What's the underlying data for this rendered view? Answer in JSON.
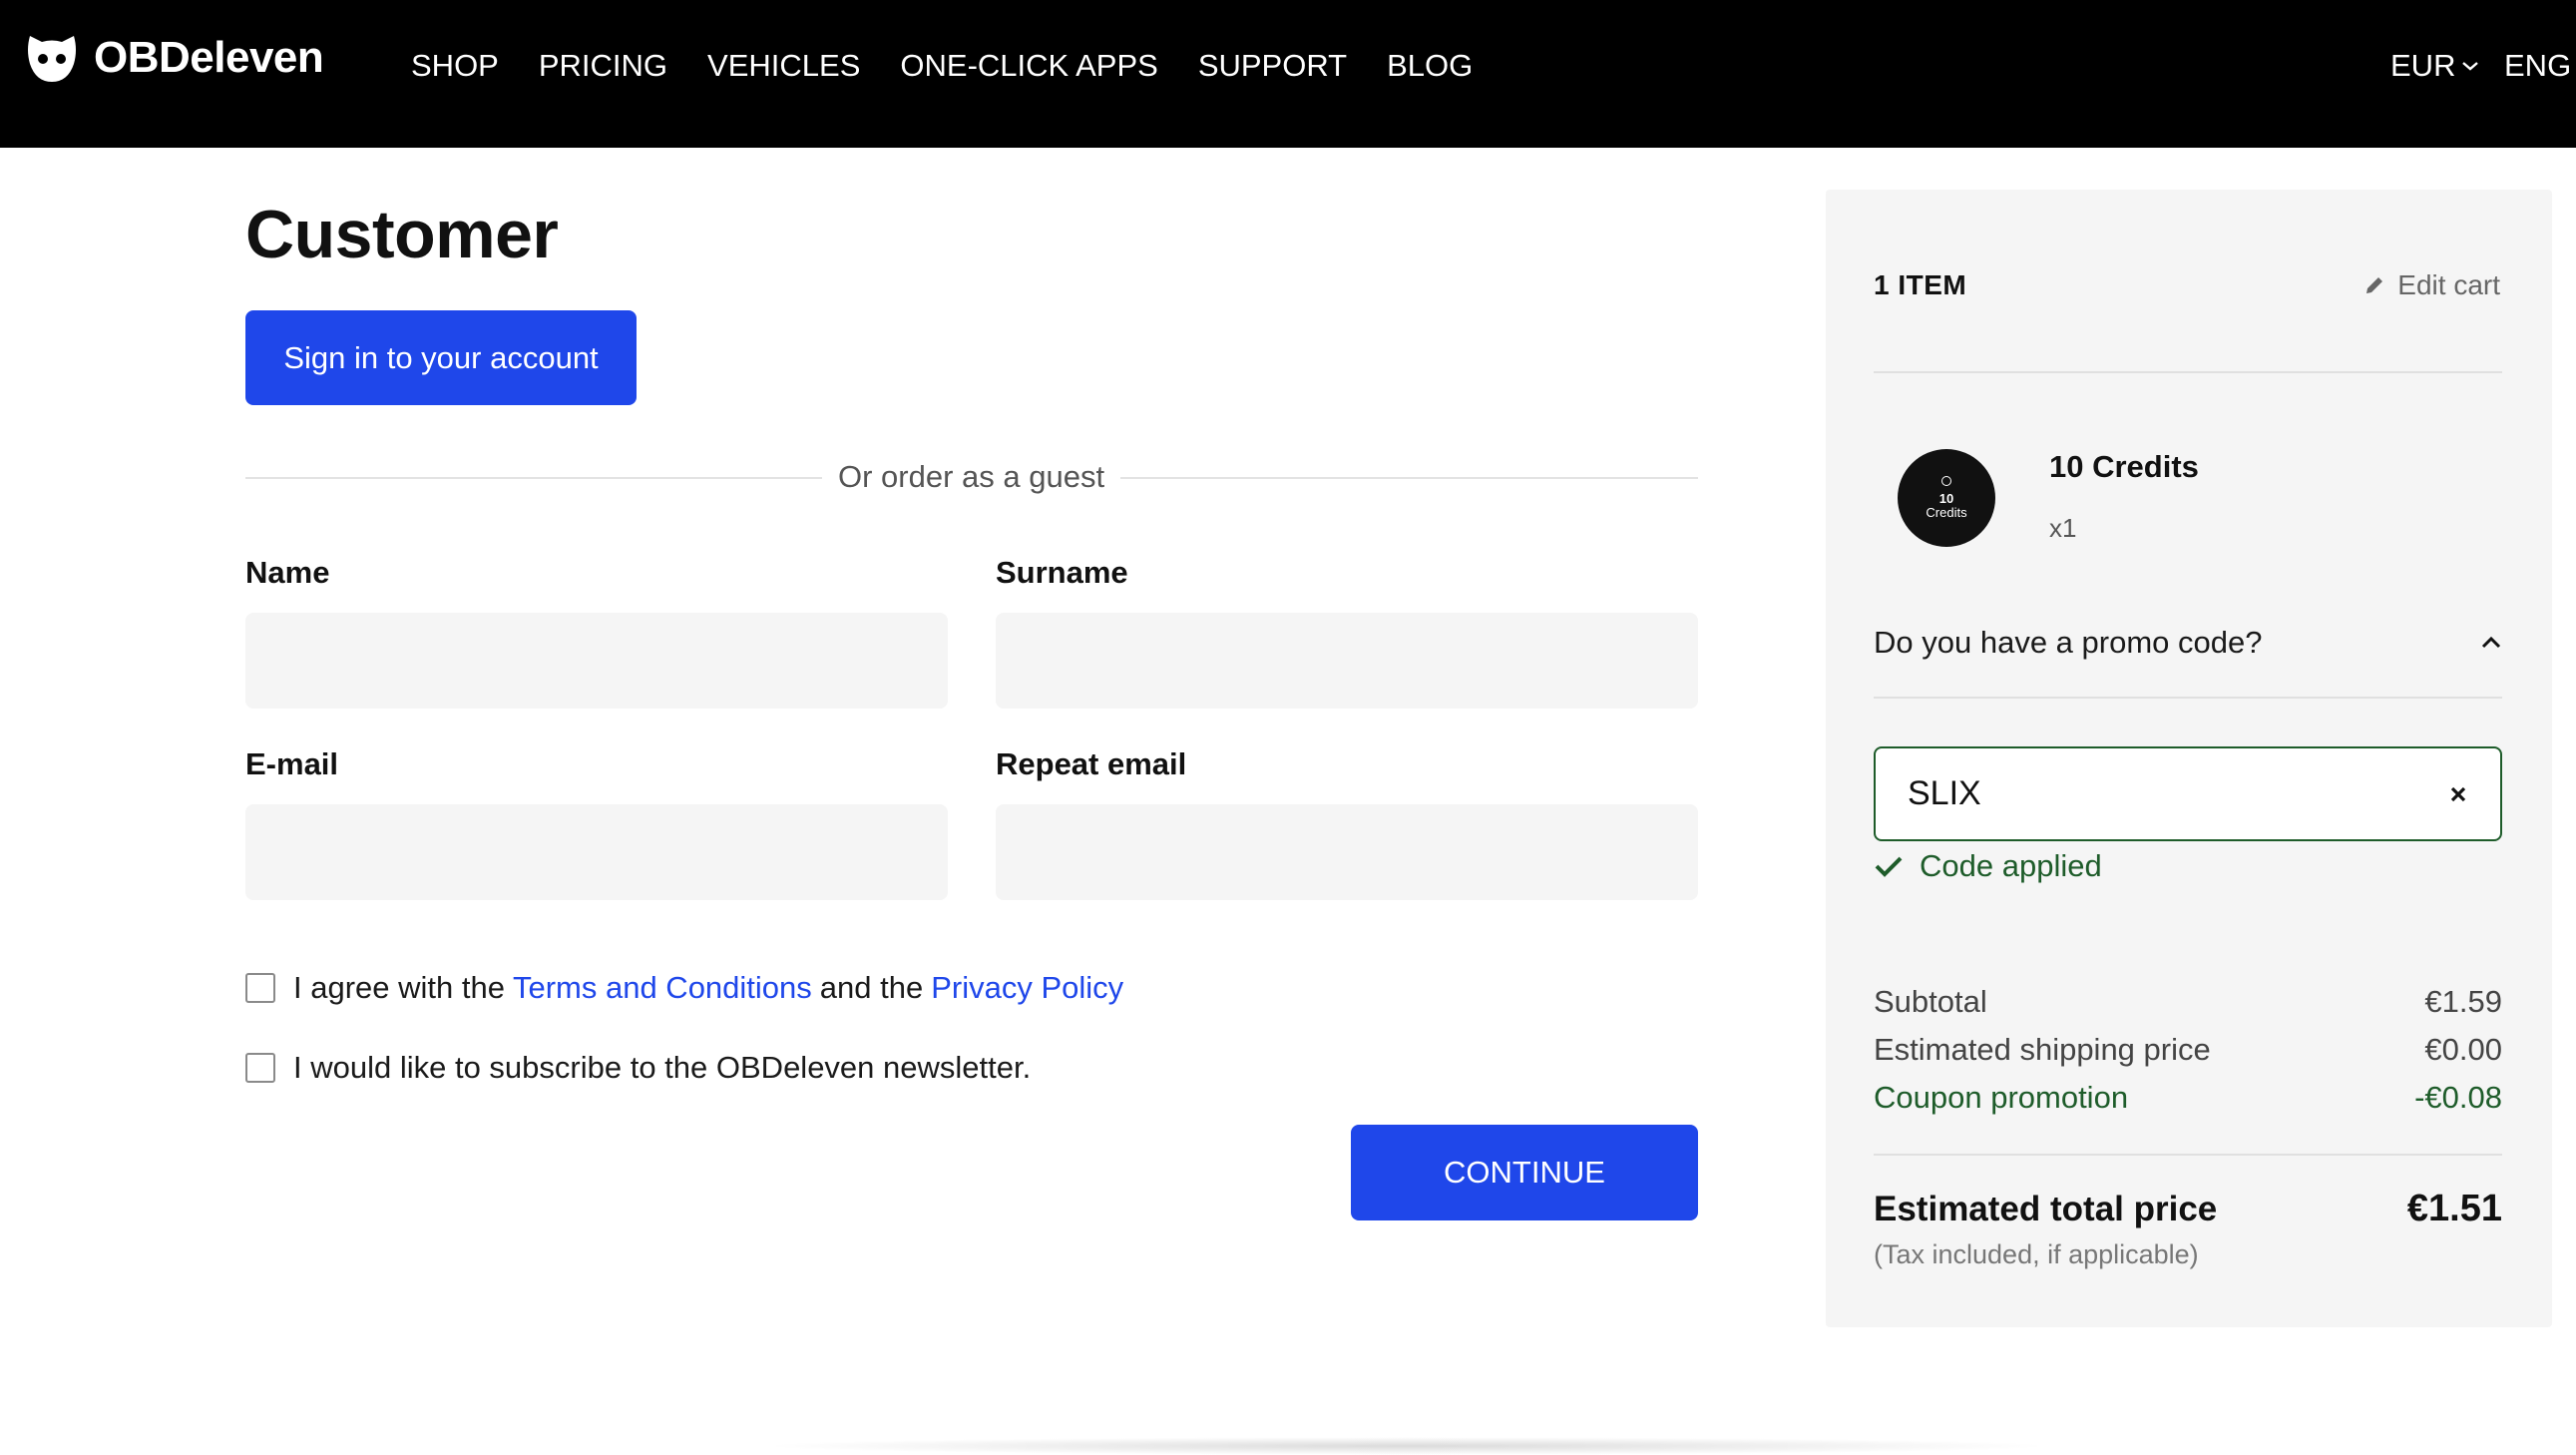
{
  "header": {
    "brand": "OBDeleven",
    "nav": [
      "SHOP",
      "PRICING",
      "VEHICLES",
      "ONE-CLICK APPS",
      "SUPPORT",
      "BLOG"
    ],
    "currency": "EUR",
    "language": "ENG"
  },
  "form": {
    "title": "Customer",
    "signin_label": "Sign in to your account",
    "guest_divider": "Or order as a guest",
    "fields": {
      "name": {
        "label": "Name",
        "value": ""
      },
      "surname": {
        "label": "Surname",
        "value": ""
      },
      "email": {
        "label": "E-mail",
        "value": ""
      },
      "repeat_email": {
        "label": "Repeat email",
        "value": ""
      }
    },
    "terms": {
      "prefix": "I agree with the",
      "terms_link": "Terms and Conditions",
      "middle": "and the",
      "privacy_link": "Privacy Policy",
      "checked": false
    },
    "newsletter": {
      "label": "I would like to subscribe to the OBDeleven newsletter.",
      "checked": false
    },
    "continue_label": "CONTINUE"
  },
  "cart": {
    "item_count": "1 ITEM",
    "edit_label": "Edit cart",
    "product": {
      "name": "10 Credits",
      "qty": "x1",
      "thumb_number": "10",
      "thumb_label": "Credits"
    },
    "promo": {
      "question": "Do you have a promo code?",
      "code": "SLIX",
      "status": "Code applied"
    },
    "summary": {
      "subtotal_label": "Subtotal",
      "subtotal_value": "€1.59",
      "shipping_label": "Estimated shipping price",
      "shipping_value": "€0.00",
      "coupon_label": "Coupon promotion",
      "coupon_value": "-€0.08",
      "total_label": "Estimated total price",
      "total_value": "€1.51",
      "tax_note": "(Tax included, if applicable)"
    }
  },
  "colors": {
    "accent": "#1f47ea",
    "success": "#1e5c2a",
    "header_bg": "#000000",
    "field_bg": "#f5f5f5"
  }
}
